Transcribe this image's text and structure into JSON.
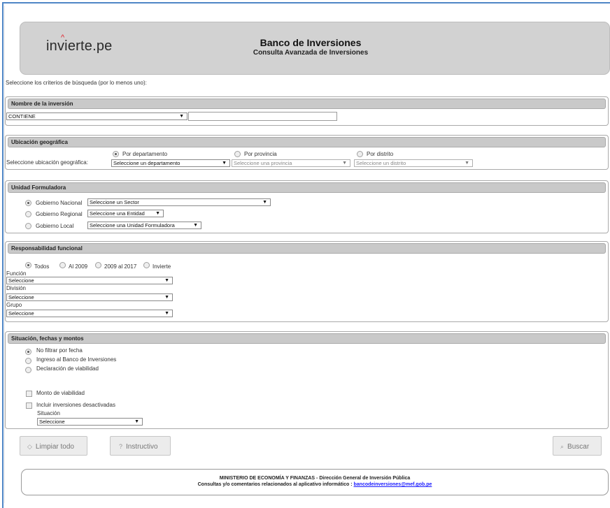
{
  "header": {
    "logo_pre": "inv",
    "logo_post": "ierte.pe",
    "title": "Banco de Inversiones",
    "subtitle": "Consulta Avanzada de Inversiones"
  },
  "intro": "Seleccione los criterios de búsqueda (por lo menos uno):",
  "nombre": {
    "title": "Nombre de la inversión",
    "operator_value": "CONTIENE",
    "text_value": ""
  },
  "ubicacion": {
    "title": "Ubicación geográfica",
    "radio_departamento": "Por departamento",
    "radio_provincia": "Por provincia",
    "radio_distrito": "Por distrito",
    "select_label": "Seleccione ubicación geográfica:",
    "departamento_value": "Seleccione un departamento",
    "provincia_value": "Seleccione una provincia",
    "distrito_value": "Seleccione un distrito"
  },
  "unidad": {
    "title": "Unidad Formuladora",
    "nacional_label": "Gobierno Nacional",
    "nacional_value": "Seleccione un Sector",
    "regional_label": "Gobierno Regional",
    "regional_value": "Seleccione una Entidad",
    "local_label": "Gobierno Local",
    "local_value": "Seleccione una Unidad Formuladora"
  },
  "responsabilidad": {
    "title": "Responsabilidad funcional",
    "radio_todos": "Todos",
    "radio_al2009": "Al 2009",
    "radio_2009_2017": "2009 al 2017",
    "radio_invierte": "Invierte",
    "funcion_label": "Función",
    "funcion_value": "Seleccione",
    "division_label": "División",
    "division_value": "Seleccione",
    "grupo_label": "Grupo",
    "grupo_value": "Seleccione"
  },
  "situacion": {
    "title": "Situación, fechas y montos",
    "radio_no_filtrar": "No filtrar por fecha",
    "radio_ingreso": "Ingreso al Banco de Inversiones",
    "radio_declaracion": "Declaración de viabilidad",
    "chk_monto": "Monto de viabilidad",
    "chk_desactivadas": "Incluir inversiones desactivadas",
    "situacion_label": "Situación",
    "situacion_value": "Seleccione"
  },
  "buttons": {
    "limpiar": "Limpiar todo",
    "instructivo": "Instructivo",
    "buscar": "Buscar"
  },
  "footer": {
    "line1": "MINISTERIO DE ECONOMÍA Y FINANZAS - Dirección General de Inversión Pública",
    "line2": "Consultas y/o comentarios relacionados al aplicativo informático :",
    "email": "bancodeinversiones@mef.gob.pe"
  },
  "colors": {
    "frame": "#4f86c6",
    "header_bg": "#d2d2d2",
    "section_head_bg": "#c9c9c9",
    "logo_accent": "#e2202a",
    "link": "#1a1aff"
  }
}
